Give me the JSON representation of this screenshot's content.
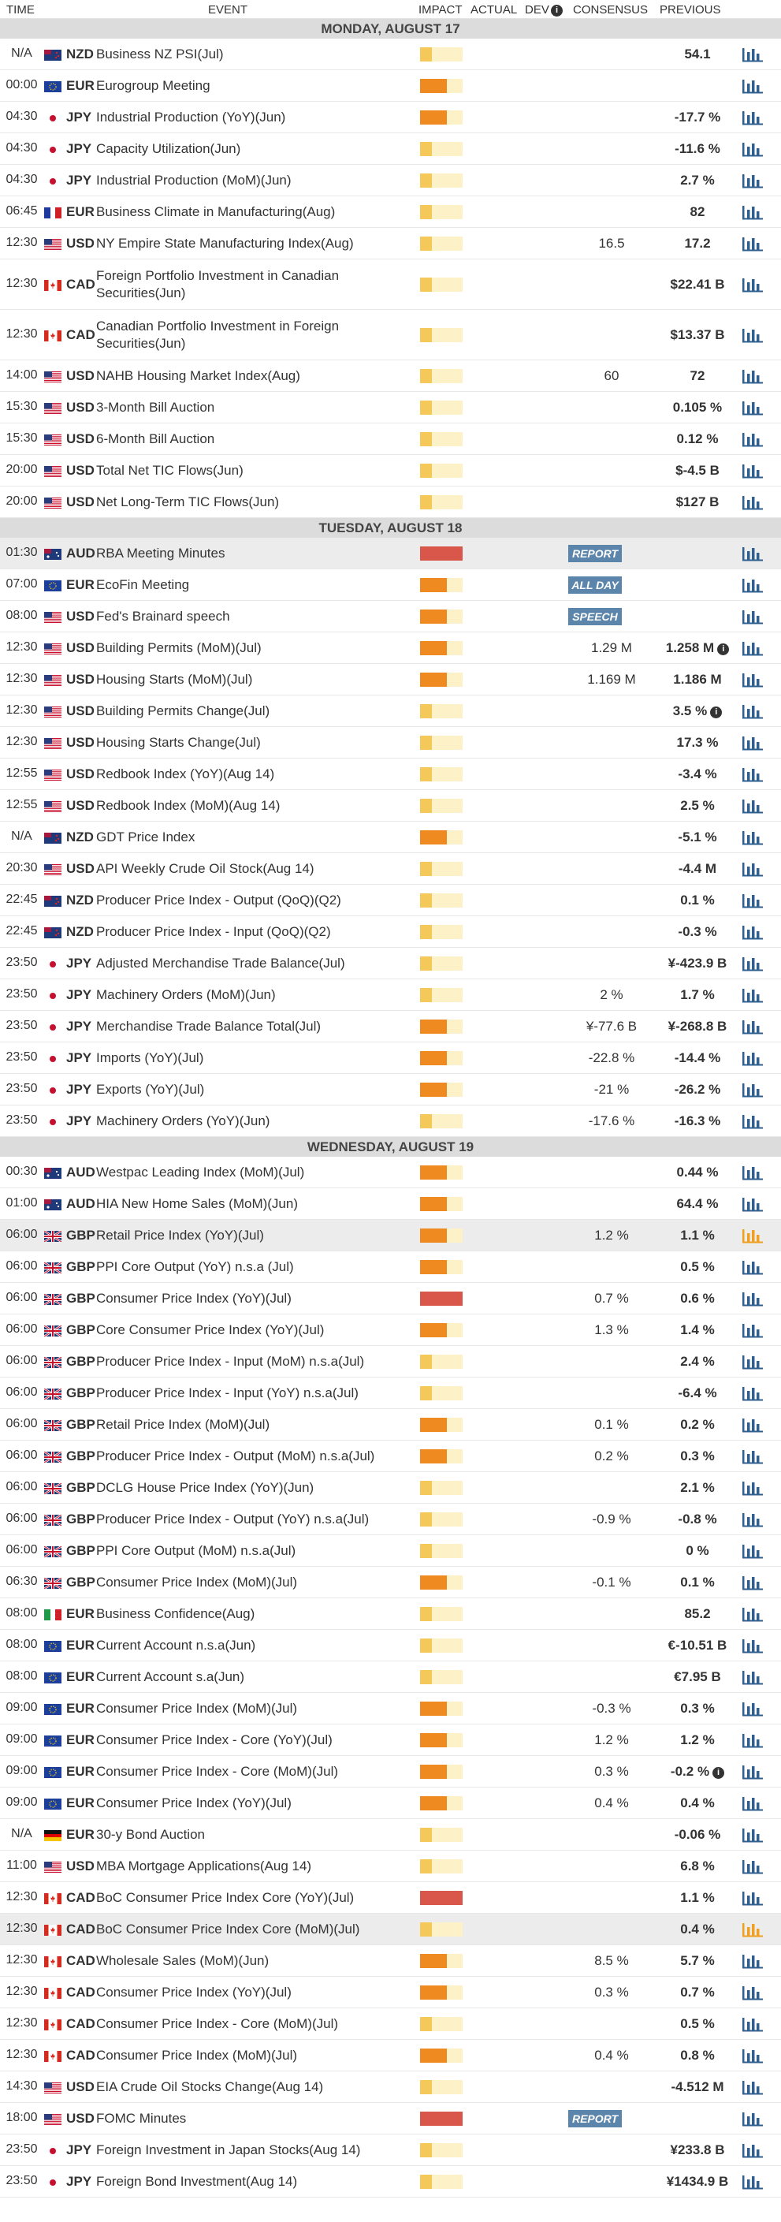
{
  "header": {
    "time": "TIME",
    "event": "EVENT",
    "impact": "IMPACT",
    "actual": "ACTUAL",
    "dev": "DEV",
    "consensus": "CONSENSUS",
    "previous": "PREVIOUS"
  },
  "colors": {
    "impact_low": "#f5c85a",
    "impact_medium": "#ee8a1f",
    "impact_high": "#d9564a",
    "badge": "#5b85ab",
    "chart_icon": "#2f5f8f",
    "chart_icon_active": "#f0a020",
    "day_header_bg": "#dcdcdc"
  },
  "days": [
    {
      "title": "MONDAY, AUGUST 17",
      "events": [
        {
          "time": "N/A",
          "flag": "nz",
          "cur": "NZD",
          "event": "Business NZ PSI(Jul)",
          "impact": 1,
          "cons": "",
          "prev": "54.1"
        },
        {
          "time": "00:00",
          "flag": "eu",
          "cur": "EUR",
          "event": "Eurogroup Meeting",
          "impact": 2,
          "cons": "",
          "prev": ""
        },
        {
          "time": "04:30",
          "flag": "jp",
          "cur": "JPY",
          "event": "Industrial Production (YoY)(Jun)",
          "impact": 2,
          "cons": "",
          "prev": "-17.7 %"
        },
        {
          "time": "04:30",
          "flag": "jp",
          "cur": "JPY",
          "event": "Capacity Utilization(Jun)",
          "impact": 1,
          "cons": "",
          "prev": "-11.6 %"
        },
        {
          "time": "04:30",
          "flag": "jp",
          "cur": "JPY",
          "event": "Industrial Production (MoM)(Jun)",
          "impact": 1,
          "cons": "",
          "prev": "2.7 %"
        },
        {
          "time": "06:45",
          "flag": "fr",
          "cur": "EUR",
          "event": "Business Climate in Manufacturing(Aug)",
          "impact": 1,
          "cons": "",
          "prev": "82"
        },
        {
          "time": "12:30",
          "flag": "us",
          "cur": "USD",
          "event": "NY Empire State Manufacturing Index(Aug)",
          "impact": 1,
          "cons": "16.5",
          "prev": "17.2"
        },
        {
          "time": "12:30",
          "flag": "ca",
          "cur": "CAD",
          "event": "Foreign Portfolio Investment in Canadian Securities(Jun)",
          "impact": 1,
          "cons": "",
          "prev": "$22.41 B",
          "tall": true
        },
        {
          "time": "12:30",
          "flag": "ca",
          "cur": "CAD",
          "event": "Canadian Portfolio Investment in Foreign Securities(Jun)",
          "impact": 1,
          "cons": "",
          "prev": "$13.37 B",
          "tall": true
        },
        {
          "time": "14:00",
          "flag": "us",
          "cur": "USD",
          "event": "NAHB Housing Market Index(Aug)",
          "impact": 1,
          "cons": "60",
          "prev": "72"
        },
        {
          "time": "15:30",
          "flag": "us",
          "cur": "USD",
          "event": "3-Month Bill Auction",
          "impact": 1,
          "cons": "",
          "prev": "0.105 %"
        },
        {
          "time": "15:30",
          "flag": "us",
          "cur": "USD",
          "event": "6-Month Bill Auction",
          "impact": 1,
          "cons": "",
          "prev": "0.12 %"
        },
        {
          "time": "20:00",
          "flag": "us",
          "cur": "USD",
          "event": "Total Net TIC Flows(Jun)",
          "impact": 1,
          "cons": "",
          "prev": "$-4.5 B"
        },
        {
          "time": "20:00",
          "flag": "us",
          "cur": "USD",
          "event": "Net Long-Term TIC Flows(Jun)",
          "impact": 1,
          "cons": "",
          "prev": "$127 B"
        }
      ]
    },
    {
      "title": "TUESDAY, AUGUST 18",
      "events": [
        {
          "time": "01:30",
          "flag": "au",
          "cur": "AUD",
          "event": "RBA Meeting Minutes",
          "impact": 3,
          "badge": "REPORT",
          "cons": "",
          "prev": "",
          "hl": true
        },
        {
          "time": "07:00",
          "flag": "eu",
          "cur": "EUR",
          "event": "EcoFin Meeting",
          "impact": 2,
          "badge": "ALL DAY",
          "cons": "",
          "prev": ""
        },
        {
          "time": "08:00",
          "flag": "us",
          "cur": "USD",
          "event": "Fed's Brainard speech",
          "impact": 2,
          "badge": "SPEECH",
          "cons": "",
          "prev": ""
        },
        {
          "time": "12:30",
          "flag": "us",
          "cur": "USD",
          "event": "Building Permits (MoM)(Jul)",
          "impact": 2,
          "cons": "1.29 M",
          "prev": "1.258 M",
          "info": true
        },
        {
          "time": "12:30",
          "flag": "us",
          "cur": "USD",
          "event": "Housing Starts (MoM)(Jul)",
          "impact": 2,
          "cons": "1.169 M",
          "prev": "1.186 M"
        },
        {
          "time": "12:30",
          "flag": "us",
          "cur": "USD",
          "event": "Building Permits Change(Jul)",
          "impact": 1,
          "cons": "",
          "prev": "3.5 %",
          "info": true
        },
        {
          "time": "12:30",
          "flag": "us",
          "cur": "USD",
          "event": "Housing Starts Change(Jul)",
          "impact": 1,
          "cons": "",
          "prev": "17.3 %"
        },
        {
          "time": "12:55",
          "flag": "us",
          "cur": "USD",
          "event": "Redbook Index (YoY)(Aug 14)",
          "impact": 1,
          "cons": "",
          "prev": "-3.4 %"
        },
        {
          "time": "12:55",
          "flag": "us",
          "cur": "USD",
          "event": "Redbook Index (MoM)(Aug 14)",
          "impact": 1,
          "cons": "",
          "prev": "2.5 %"
        },
        {
          "time": "N/A",
          "flag": "nz",
          "cur": "NZD",
          "event": "GDT Price Index",
          "impact": 2,
          "cons": "",
          "prev": "-5.1 %"
        },
        {
          "time": "20:30",
          "flag": "us",
          "cur": "USD",
          "event": "API Weekly Crude Oil Stock(Aug 14)",
          "impact": 1,
          "cons": "",
          "prev": "-4.4 M"
        },
        {
          "time": "22:45",
          "flag": "nz",
          "cur": "NZD",
          "event": "Producer Price Index - Output (QoQ)(Q2)",
          "impact": 1,
          "cons": "",
          "prev": "0.1 %"
        },
        {
          "time": "22:45",
          "flag": "nz",
          "cur": "NZD",
          "event": "Producer Price Index - Input (QoQ)(Q2)",
          "impact": 1,
          "cons": "",
          "prev": "-0.3 %"
        },
        {
          "time": "23:50",
          "flag": "jp",
          "cur": "JPY",
          "event": "Adjusted Merchandise Trade Balance(Jul)",
          "impact": 1,
          "cons": "",
          "prev": "¥-423.9 B"
        },
        {
          "time": "23:50",
          "flag": "jp",
          "cur": "JPY",
          "event": "Machinery Orders (MoM)(Jun)",
          "impact": 1,
          "cons": "2 %",
          "prev": "1.7 %"
        },
        {
          "time": "23:50",
          "flag": "jp",
          "cur": "JPY",
          "event": "Merchandise Trade Balance Total(Jul)",
          "impact": 2,
          "cons": "¥-77.6 B",
          "prev": "¥-268.8 B"
        },
        {
          "time": "23:50",
          "flag": "jp",
          "cur": "JPY",
          "event": "Imports (YoY)(Jul)",
          "impact": 2,
          "cons": "-22.8 %",
          "prev": "-14.4 %"
        },
        {
          "time": "23:50",
          "flag": "jp",
          "cur": "JPY",
          "event": "Exports (YoY)(Jul)",
          "impact": 2,
          "cons": "-21 %",
          "prev": "-26.2 %"
        },
        {
          "time": "23:50",
          "flag": "jp",
          "cur": "JPY",
          "event": "Machinery Orders (YoY)(Jun)",
          "impact": 1,
          "cons": "-17.6 %",
          "prev": "-16.3 %"
        }
      ]
    },
    {
      "title": "WEDNESDAY, AUGUST 19",
      "events": [
        {
          "time": "00:30",
          "flag": "au",
          "cur": "AUD",
          "event": "Westpac Leading Index (MoM)(Jul)",
          "impact": 2,
          "cons": "",
          "prev": "0.44 %"
        },
        {
          "time": "01:00",
          "flag": "au",
          "cur": "AUD",
          "event": "HIA New Home Sales (MoM)(Jun)",
          "impact": 2,
          "cons": "",
          "prev": "64.4 %"
        },
        {
          "time": "06:00",
          "flag": "gb",
          "cur": "GBP",
          "event": "Retail Price Index (YoY)(Jul)",
          "impact": 2,
          "cons": "1.2 %",
          "prev": "1.1 %",
          "hl": true,
          "active": true
        },
        {
          "time": "06:00",
          "flag": "gb",
          "cur": "GBP",
          "event": "PPI Core Output (YoY) n.s.a (Jul)",
          "impact": 2,
          "cons": "",
          "prev": "0.5 %"
        },
        {
          "time": "06:00",
          "flag": "gb",
          "cur": "GBP",
          "event": "Consumer Price Index (YoY)(Jul)",
          "impact": 3,
          "cons": "0.7 %",
          "prev": "0.6 %"
        },
        {
          "time": "06:00",
          "flag": "gb",
          "cur": "GBP",
          "event": "Core Consumer Price Index (YoY)(Jul)",
          "impact": 2,
          "cons": "1.3 %",
          "prev": "1.4 %"
        },
        {
          "time": "06:00",
          "flag": "gb",
          "cur": "GBP",
          "event": "Producer Price Index - Input (MoM) n.s.a(Jul)",
          "impact": 1,
          "cons": "",
          "prev": "2.4 %"
        },
        {
          "time": "06:00",
          "flag": "gb",
          "cur": "GBP",
          "event": "Producer Price Index - Input (YoY) n.s.a(Jul)",
          "impact": 1,
          "cons": "",
          "prev": "-6.4 %"
        },
        {
          "time": "06:00",
          "flag": "gb",
          "cur": "GBP",
          "event": "Retail Price Index (MoM)(Jul)",
          "impact": 2,
          "cons": "0.1 %",
          "prev": "0.2 %"
        },
        {
          "time": "06:00",
          "flag": "gb",
          "cur": "GBP",
          "event": "Producer Price Index - Output (MoM) n.s.a(Jul)",
          "impact": 2,
          "cons": "0.2 %",
          "prev": "0.3 %"
        },
        {
          "time": "06:00",
          "flag": "gb",
          "cur": "GBP",
          "event": "DCLG House Price Index (YoY)(Jun)",
          "impact": 1,
          "cons": "",
          "prev": "2.1 %"
        },
        {
          "time": "06:00",
          "flag": "gb",
          "cur": "GBP",
          "event": "Producer Price Index - Output (YoY) n.s.a(Jul)",
          "impact": 1,
          "cons": "-0.9 %",
          "prev": "-0.8 %"
        },
        {
          "time": "06:00",
          "flag": "gb",
          "cur": "GBP",
          "event": "PPI Core Output (MoM) n.s.a(Jul)",
          "impact": 1,
          "cons": "",
          "prev": "0 %"
        },
        {
          "time": "06:30",
          "flag": "gb",
          "cur": "GBP",
          "event": "Consumer Price Index (MoM)(Jul)",
          "impact": 2,
          "cons": "-0.1 %",
          "prev": "0.1 %"
        },
        {
          "time": "08:00",
          "flag": "it",
          "cur": "EUR",
          "event": "Business Confidence(Aug)",
          "impact": 1,
          "cons": "",
          "prev": "85.2"
        },
        {
          "time": "08:00",
          "flag": "eu",
          "cur": "EUR",
          "event": "Current Account n.s.a(Jun)",
          "impact": 1,
          "cons": "",
          "prev": "€-10.51 B"
        },
        {
          "time": "08:00",
          "flag": "eu",
          "cur": "EUR",
          "event": "Current Account s.a(Jun)",
          "impact": 1,
          "cons": "",
          "prev": "€7.95 B"
        },
        {
          "time": "09:00",
          "flag": "eu",
          "cur": "EUR",
          "event": "Consumer Price Index (MoM)(Jul)",
          "impact": 2,
          "cons": "-0.3 %",
          "prev": "0.3 %"
        },
        {
          "time": "09:00",
          "flag": "eu",
          "cur": "EUR",
          "event": "Consumer Price Index - Core (YoY)(Jul)",
          "impact": 2,
          "cons": "1.2 %",
          "prev": "1.2 %"
        },
        {
          "time": "09:00",
          "flag": "eu",
          "cur": "EUR",
          "event": "Consumer Price Index - Core (MoM)(Jul)",
          "impact": 2,
          "cons": "0.3 %",
          "prev": "-0.2 %",
          "info": true
        },
        {
          "time": "09:00",
          "flag": "eu",
          "cur": "EUR",
          "event": "Consumer Price Index (YoY)(Jul)",
          "impact": 2,
          "cons": "0.4 %",
          "prev": "0.4 %"
        },
        {
          "time": "N/A",
          "flag": "de",
          "cur": "EUR",
          "event": "30-y Bond Auction",
          "impact": 1,
          "cons": "",
          "prev": "-0.06 %"
        },
        {
          "time": "11:00",
          "flag": "us",
          "cur": "USD",
          "event": "MBA Mortgage Applications(Aug 14)",
          "impact": 1,
          "cons": "",
          "prev": "6.8 %"
        },
        {
          "time": "12:30",
          "flag": "ca",
          "cur": "CAD",
          "event": "BoC Consumer Price Index Core (YoY)(Jul)",
          "impact": 3,
          "cons": "",
          "prev": "1.1 %"
        },
        {
          "time": "12:30",
          "flag": "ca",
          "cur": "CAD",
          "event": "BoC Consumer Price Index Core (MoM)(Jul)",
          "impact": 1,
          "cons": "",
          "prev": "0.4 %",
          "hl": true,
          "active": true
        },
        {
          "time": "12:30",
          "flag": "ca",
          "cur": "CAD",
          "event": "Wholesale Sales (MoM)(Jun)",
          "impact": 2,
          "cons": "8.5 %",
          "prev": "5.7 %"
        },
        {
          "time": "12:30",
          "flag": "ca",
          "cur": "CAD",
          "event": "Consumer Price Index (YoY)(Jul)",
          "impact": 2,
          "cons": "0.3 %",
          "prev": "0.7 %"
        },
        {
          "time": "12:30",
          "flag": "ca",
          "cur": "CAD",
          "event": "Consumer Price Index - Core (MoM)(Jul)",
          "impact": 1,
          "cons": "",
          "prev": "0.5 %"
        },
        {
          "time": "12:30",
          "flag": "ca",
          "cur": "CAD",
          "event": "Consumer Price Index (MoM)(Jul)",
          "impact": 2,
          "cons": "0.4 %",
          "prev": "0.8 %"
        },
        {
          "time": "14:30",
          "flag": "us",
          "cur": "USD",
          "event": "EIA Crude Oil Stocks Change(Aug 14)",
          "impact": 1,
          "cons": "",
          "prev": "-4.512 M"
        },
        {
          "time": "18:00",
          "flag": "us",
          "cur": "USD",
          "event": "FOMC Minutes",
          "impact": 3,
          "badge": "REPORT",
          "cons": "",
          "prev": ""
        },
        {
          "time": "23:50",
          "flag": "jp",
          "cur": "JPY",
          "event": "Foreign Investment in Japan Stocks(Aug 14)",
          "impact": 1,
          "cons": "",
          "prev": "¥233.8 B"
        },
        {
          "time": "23:50",
          "flag": "jp",
          "cur": "JPY",
          "event": "Foreign Bond Investment(Aug 14)",
          "impact": 1,
          "cons": "",
          "prev": "¥1434.9 B"
        }
      ]
    }
  ]
}
